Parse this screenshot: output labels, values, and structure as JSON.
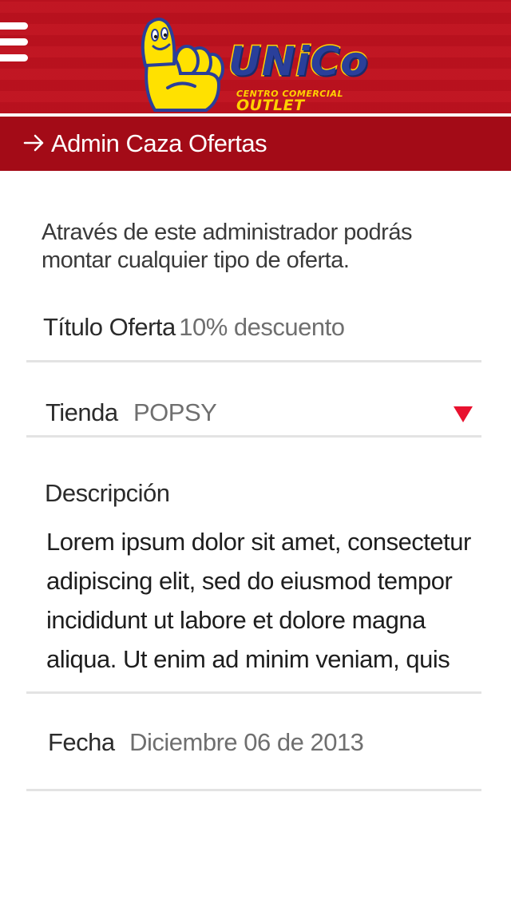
{
  "header": {
    "menu_icon": "hamburger-menu-icon",
    "logo": {
      "wordmark": "UNiCo",
      "tagline": "CENTRO COMERCIAL",
      "tagline_emphasis": "OUTLET"
    },
    "title": "Admin Caza Ofertas",
    "title_icon": "arrow-right-icon"
  },
  "colors": {
    "brand_red": "#c0121f",
    "title_bar_red": "#a30b17",
    "accent_red": "#e8122f",
    "logo_blue": "#2a3f9a",
    "logo_yellow": "#ffd200"
  },
  "intro_text": "Através de este administrador podrás montar cualquier tipo de oferta.",
  "form": {
    "title_field": {
      "label": "Título Oferta",
      "value": "10% descuento"
    },
    "store_field": {
      "label": "Tienda",
      "value": "POPSY",
      "icon": "dropdown-triangle-icon"
    },
    "description_field": {
      "label": "Descripción",
      "value": "Lorem ipsum dolor sit amet, consectetur adipiscing elit, sed do eiusmod tempor incididunt ut labore et dolore magna aliqua. Ut enim ad minim veniam, quis"
    },
    "date_field": {
      "label": "Fecha",
      "value": "Diciembre 06 de 2013"
    }
  }
}
